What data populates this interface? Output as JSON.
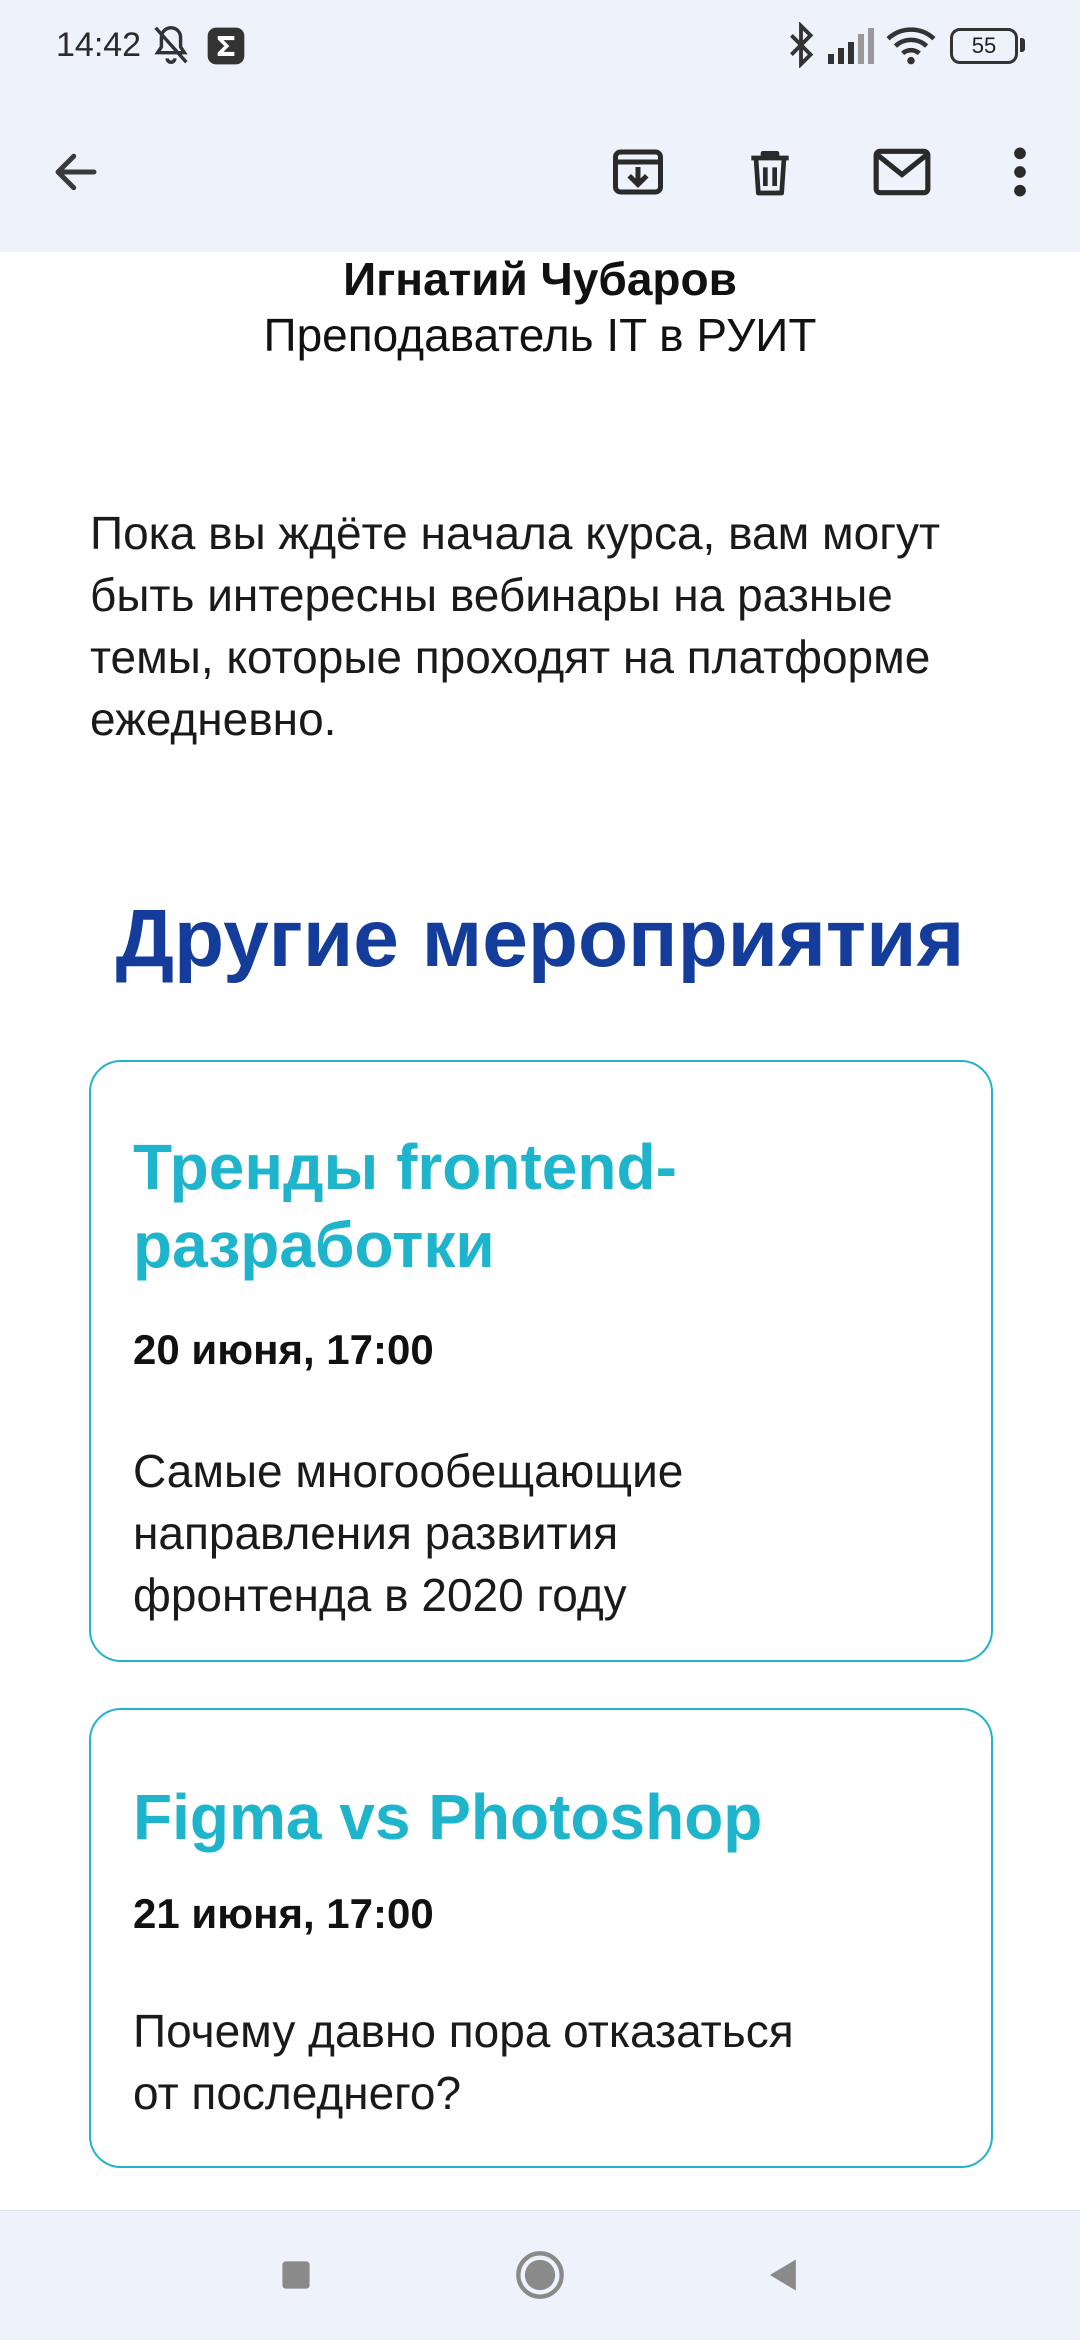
{
  "status": {
    "time": "14:42",
    "battery": "55",
    "icons": [
      "mute-icon",
      "app-sigma-icon",
      "bluetooth-icon",
      "signal-icon",
      "wifi-icon",
      "battery-icon"
    ]
  },
  "toolbar": {
    "icons": [
      "back-arrow-icon",
      "archive-icon",
      "delete-icon",
      "mark-unread-icon",
      "more-vert-icon"
    ]
  },
  "email": {
    "sender_name": "Игнатий Чубаров",
    "sender_role": "Преподаватель IT в РУИТ",
    "intro": "Пока вы ждёте начала курса, вам могут быть интересны вебинары на разные темы, которые проходят на платформе ежедневно.",
    "section_title": "Другие мероприятия",
    "events": [
      {
        "title_line1": "Тренды frontend-",
        "title_line2": "разработки",
        "date": "20 июня, 17:00",
        "desc_line1": "Самые многообещающие",
        "desc_line2": "направления развития",
        "desc_line3": "фронтенда в 2020 году"
      },
      {
        "title_line1": "Figma vs Photoshop",
        "date": "21 июня, 17:00",
        "desc_line1": "Почему давно пора отказаться",
        "desc_line2": "от последнего?"
      }
    ]
  },
  "colors": {
    "bar_background": "#eef2fb",
    "section_title": "#143c9a",
    "card_accent": "#1eb4cc"
  },
  "navbar": {
    "icons": [
      "recents-square-icon",
      "home-circle-icon",
      "back-triangle-icon"
    ]
  }
}
